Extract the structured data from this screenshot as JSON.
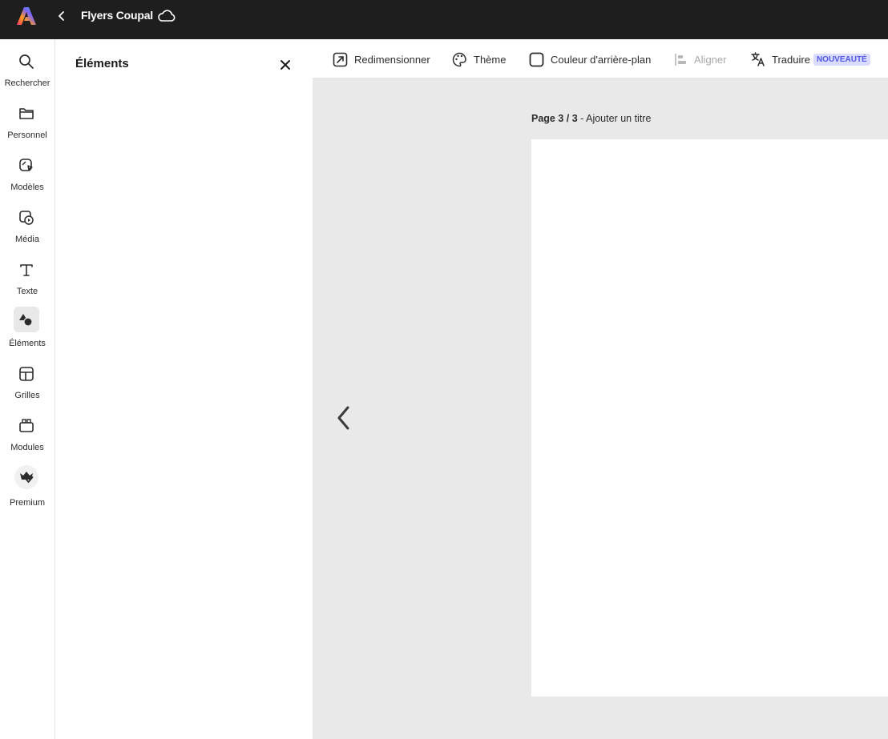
{
  "topbar": {
    "title": "Flyers Coupal"
  },
  "rail": {
    "items": [
      {
        "label": "Rechercher",
        "icon": "search-icon"
      },
      {
        "label": "Personnel",
        "icon": "folder-icon"
      },
      {
        "label": "Modèles",
        "icon": "templates-icon"
      },
      {
        "label": "Média",
        "icon": "media-icon"
      },
      {
        "label": "Texte",
        "icon": "text-icon"
      },
      {
        "label": "Éléments",
        "icon": "elements-icon",
        "active": true
      },
      {
        "label": "Grilles",
        "icon": "grids-icon"
      },
      {
        "label": "Modules",
        "icon": "addons-icon"
      },
      {
        "label": "Premium",
        "icon": "premium-crown-icon"
      }
    ]
  },
  "panel": {
    "title": "Éléments"
  },
  "toolbar": {
    "resize": "Redimensionner",
    "theme": "Thème",
    "background": "Couleur d'arrière-plan",
    "align": "Aligner",
    "translate": "Traduire",
    "new_badge": "NOUVEAUTÉ"
  },
  "canvas": {
    "page_prefix": "Page 3 / 3",
    "page_sep": " - ",
    "page_title_placeholder": "Ajouter un titre"
  },
  "colors": {
    "topbar_bg": "#1e1e1e",
    "canvas_bg": "#e9e9e9",
    "badge_bg": "#d9dbff",
    "badge_text": "#5258e4"
  }
}
